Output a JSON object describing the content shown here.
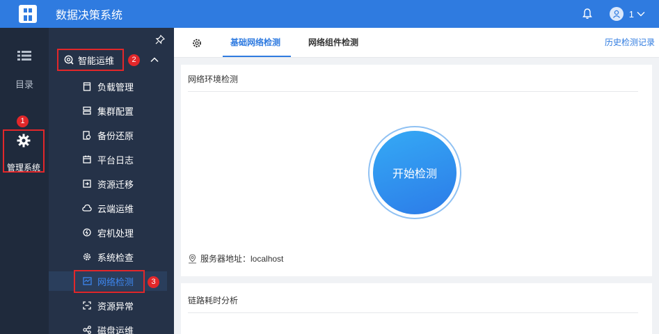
{
  "app": {
    "title": "数据决策系统",
    "user_name": "1"
  },
  "leftnav": {
    "directory_label": "目录",
    "management_label": "管理系统",
    "badge_1": "1"
  },
  "sidebar": {
    "group_label": "智能运维",
    "badge_2": "2",
    "badge_3": "3",
    "items": [
      {
        "label": "负载管理",
        "icon": "load-icon"
      },
      {
        "label": "集群配置",
        "icon": "cluster-icon"
      },
      {
        "label": "备份还原",
        "icon": "backup-icon"
      },
      {
        "label": "平台日志",
        "icon": "calendar-icon"
      },
      {
        "label": "资源迁移",
        "icon": "migrate-icon"
      },
      {
        "label": "云端运维",
        "icon": "cloud-icon"
      },
      {
        "label": "宕机处理",
        "icon": "power-icon"
      },
      {
        "label": "系统检查",
        "icon": "gear-icon"
      },
      {
        "label": "网络检测",
        "icon": "monitor-icon"
      },
      {
        "label": "资源异常",
        "icon": "scan-icon"
      },
      {
        "label": "磁盘运维",
        "icon": "share-icon"
      }
    ],
    "active_index": 8
  },
  "tabs": {
    "items": [
      "基础网络检测",
      "网络组件检测"
    ],
    "active": 0,
    "history_link": "历史检测记录"
  },
  "network_env": {
    "title": "网络环境检测",
    "start_button": "开始检测",
    "server_label": "服务器地址：",
    "server_value": "localhost"
  },
  "link_analysis": {
    "title": "链路耗时分析"
  },
  "colors": {
    "accent": "#2f7be0",
    "sidebar": "#253248",
    "leftnav": "#1f2a3c",
    "highlight": "#e2272a"
  }
}
